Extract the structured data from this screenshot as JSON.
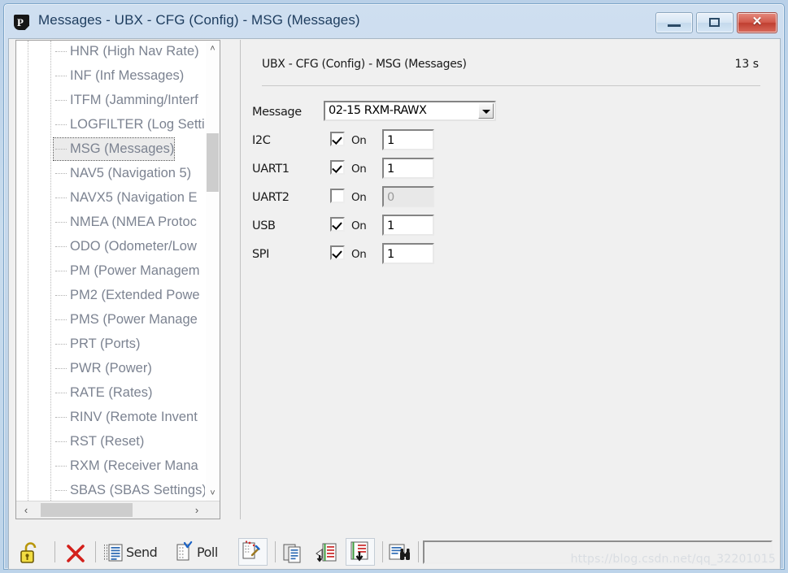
{
  "window": {
    "title": "Messages - UBX - CFG (Config) - MSG (Messages)",
    "app_icon": "p-logo-icon",
    "buttons": {
      "minimize": "minimize-icon",
      "maximize": "maximize-icon",
      "close": "✕"
    }
  },
  "tree": {
    "items": [
      {
        "label": "HNR (High Nav Rate)",
        "selected": false
      },
      {
        "label": "INF (Inf Messages)",
        "selected": false
      },
      {
        "label": "ITFM (Jamming/Interf",
        "selected": false
      },
      {
        "label": "LOGFILTER (Log Setti",
        "selected": false
      },
      {
        "label": "MSG (Messages)",
        "selected": true
      },
      {
        "label": "NAV5 (Navigation 5)",
        "selected": false
      },
      {
        "label": "NAVX5 (Navigation E",
        "selected": false
      },
      {
        "label": "NMEA (NMEA Protoc",
        "selected": false
      },
      {
        "label": "ODO (Odometer/Low",
        "selected": false
      },
      {
        "label": "PM (Power Managem",
        "selected": false
      },
      {
        "label": "PM2 (Extended Powe",
        "selected": false
      },
      {
        "label": "PMS (Power Manage",
        "selected": false
      },
      {
        "label": "PRT (Ports)",
        "selected": false
      },
      {
        "label": "PWR (Power)",
        "selected": false
      },
      {
        "label": "RATE (Rates)",
        "selected": false
      },
      {
        "label": "RINV (Remote Invent",
        "selected": false
      },
      {
        "label": "RST (Reset)",
        "selected": false
      },
      {
        "label": "RXM (Receiver Mana",
        "selected": false
      },
      {
        "label": "SBAS (SBAS Settings)",
        "selected": false
      }
    ],
    "scroll_up": "˄",
    "scroll_down": "˅",
    "scroll_left": "‹",
    "scroll_right": "›"
  },
  "panel": {
    "title": "UBX - CFG (Config) - MSG (Messages)",
    "time": "13 s",
    "message_label": "Message",
    "message_value": "02-15 RXM-RAWX",
    "rows": [
      {
        "label": "I2C",
        "checked": true,
        "on_label": "On",
        "rate": "1",
        "enabled": true
      },
      {
        "label": "UART1",
        "checked": true,
        "on_label": "On",
        "rate": "1",
        "enabled": true
      },
      {
        "label": "UART2",
        "checked": false,
        "on_label": "On",
        "rate": "0",
        "enabled": false
      },
      {
        "label": "USB",
        "checked": true,
        "on_label": "On",
        "rate": "1",
        "enabled": true
      },
      {
        "label": "SPI",
        "checked": true,
        "on_label": "On",
        "rate": "1",
        "enabled": true
      }
    ]
  },
  "toolbar": {
    "unlock_icon": "unlock-padlock-icon",
    "clear_icon": "red-x-icon",
    "send_label": "Send",
    "send_icon": "send-document-icon",
    "poll_label": "Poll",
    "poll_icon": "poll-document-icon",
    "tool3_icon": "document-wand-icon",
    "tool4_icon": "copy-documents-icon",
    "tool5_icon": "import-list-icon",
    "tool6_icon": "export-list-icon",
    "tool7_icon": "list-binoculars-icon",
    "field_value": ""
  },
  "watermark": "https://blog.csdn.net/qq_32201015",
  "colors": {
    "titlebar_start": "#cfdff0",
    "titlebar_end": "#b4cce4",
    "close_red": "#bf3f31",
    "tree_text": "#7c8391",
    "panel_bg": "#f0f0f0"
  }
}
